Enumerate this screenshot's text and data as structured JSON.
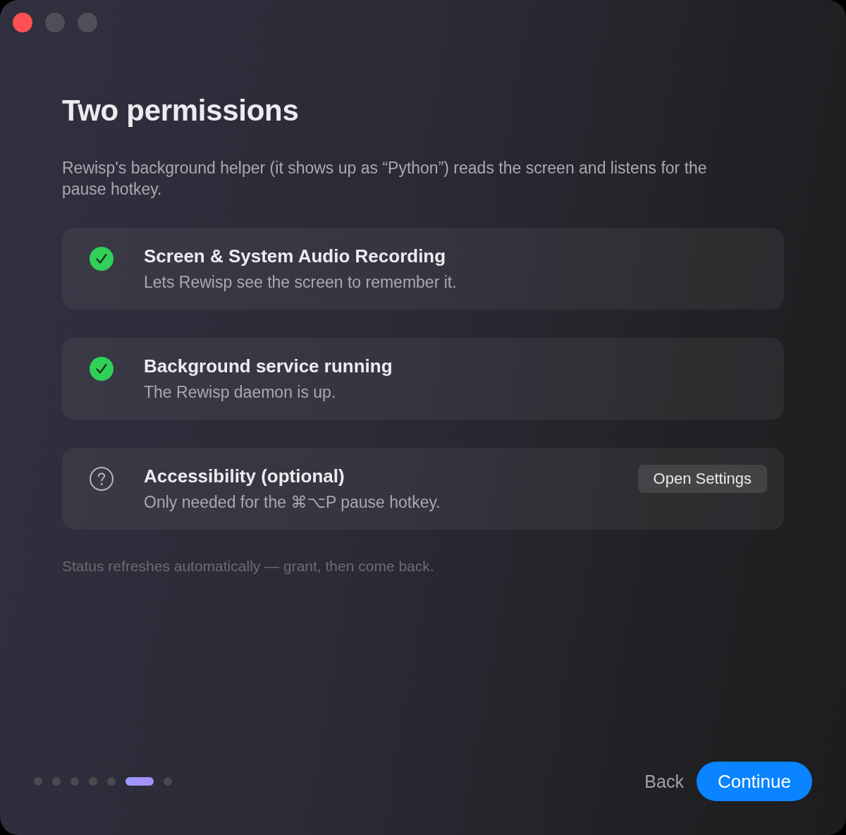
{
  "window": {
    "controls": [
      {
        "kind": "close",
        "disabled": false
      },
      {
        "kind": "minimize",
        "disabled": true
      },
      {
        "kind": "zoom",
        "disabled": true
      }
    ]
  },
  "title": "Two permissions",
  "description": "Rewisp's background helper (it shows up as “Python”) reads the screen and listens for the pause hotkey.",
  "permissions": [
    {
      "title": "Screen & System Audio Recording",
      "subtitle": "Lets Rewisp see the screen to remember it.",
      "granted": true
    },
    {
      "title": "Background service running",
      "subtitle": "The Rewisp daemon is up.",
      "granted": true
    },
    {
      "title": "Accessibility (optional)",
      "subtitle": "Only needed for the ⌘⌥P pause hotkey.",
      "granted": false,
      "action": "Open Settings"
    }
  ],
  "footnote": "Status refreshes automatically — grant, then come back.",
  "pager": {
    "pages": [
      {
        "selected": false
      },
      {
        "selected": false
      },
      {
        "selected": false
      },
      {
        "selected": false
      },
      {
        "selected": false
      },
      {
        "selected": true
      },
      {
        "selected": false
      }
    ]
  },
  "buttons": {
    "back": "Back",
    "continue": "Continue"
  }
}
